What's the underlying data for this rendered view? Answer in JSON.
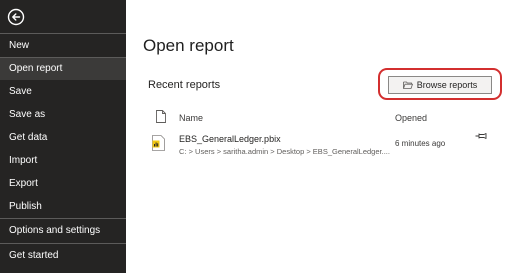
{
  "sidebar": {
    "back_icon": "back-arrow-circle-icon",
    "items": [
      {
        "label": "New",
        "active": false
      },
      {
        "label": "Open report",
        "active": true
      },
      {
        "label": "Save",
        "active": false
      },
      {
        "label": "Save as",
        "active": false
      },
      {
        "label": "Get data",
        "active": false
      },
      {
        "label": "Import",
        "active": false
      },
      {
        "label": "Export",
        "active": false
      },
      {
        "label": "Publish",
        "active": false
      },
      {
        "label": "Options and settings",
        "active": false
      },
      {
        "label": "Get started",
        "active": false
      }
    ]
  },
  "main": {
    "title": "Open report",
    "section_title": "Recent reports",
    "browse_label": "Browse reports",
    "columns": {
      "name": "Name",
      "opened": "Opened"
    },
    "files": [
      {
        "name": "EBS_GeneralLedger.pbix",
        "path": "C: > Users > saritha.admin > Desktop > EBS_GeneralLedger....",
        "opened": "6 minutes ago"
      }
    ]
  },
  "colors": {
    "sidebar_bg": "#252423",
    "active_item_bg": "#3b3a39",
    "highlight": "#d32f2f",
    "pbix_icon": "#f2c811"
  }
}
